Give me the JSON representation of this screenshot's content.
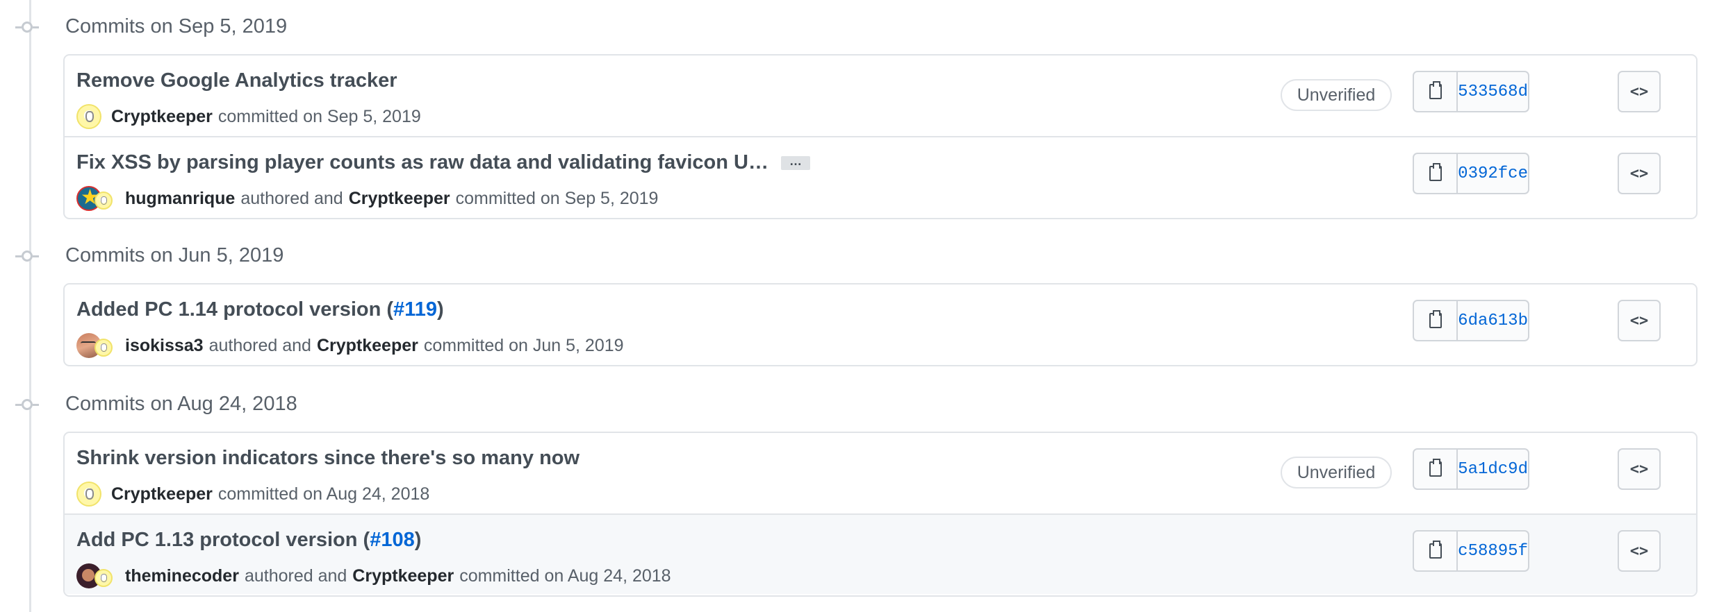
{
  "groups": [
    {
      "header": "Commits on Sep 5, 2019",
      "commits": [
        {
          "message": "Remove Google Analytics tracker",
          "pr": "",
          "authored_by": "",
          "committer": "Cryptkeeper",
          "authored_text": "",
          "committed_text": "committed on Sep 5, 2019",
          "badge": "Unverified",
          "sha": "533568d",
          "truncated": false
        },
        {
          "message": "Fix XSS by parsing player counts as raw data and validating favicon U…",
          "pr": "",
          "authored_by": "hugmanrique",
          "committer": "Cryptkeeper",
          "authored_text": "authored and",
          "committed_text": "committed on Sep 5, 2019",
          "badge": "",
          "sha": "0392fce",
          "truncated": true,
          "ellipsis": "…"
        }
      ]
    },
    {
      "header": "Commits on Jun 5, 2019",
      "commits": [
        {
          "message": "Added PC 1.14 protocol version (",
          "pr": "#119",
          "message_end": ")",
          "authored_by": "isokissa3",
          "committer": "Cryptkeeper",
          "authored_text": "authored and",
          "committed_text": "committed on Jun 5, 2019",
          "badge": "",
          "sha": "6da613b"
        }
      ]
    },
    {
      "header": "Commits on Aug 24, 2018",
      "commits": [
        {
          "message": "Shrink version indicators since there's so many now",
          "pr": "",
          "authored_by": "",
          "committer": "Cryptkeeper",
          "authored_text": "",
          "committed_text": "committed on Aug 24, 2018",
          "badge": "Unverified",
          "sha": "5a1dc9d"
        },
        {
          "message": "Add PC 1.13 protocol version (",
          "pr": "#108",
          "message_end": ")",
          "authored_by": "theminecoder",
          "committer": "Cryptkeeper",
          "authored_text": "authored and",
          "committed_text": "committed on Aug 24, 2018",
          "badge": "",
          "sha": "c58895f"
        }
      ]
    }
  ],
  "icons": {
    "copy": "clipboard-icon",
    "browse": "code-icon",
    "browse_glyph": "<>",
    "timeline": "commit-node-icon"
  },
  "colors": {
    "link": "#0366d6",
    "border": "#e1e4e8",
    "muted": "#586069"
  }
}
